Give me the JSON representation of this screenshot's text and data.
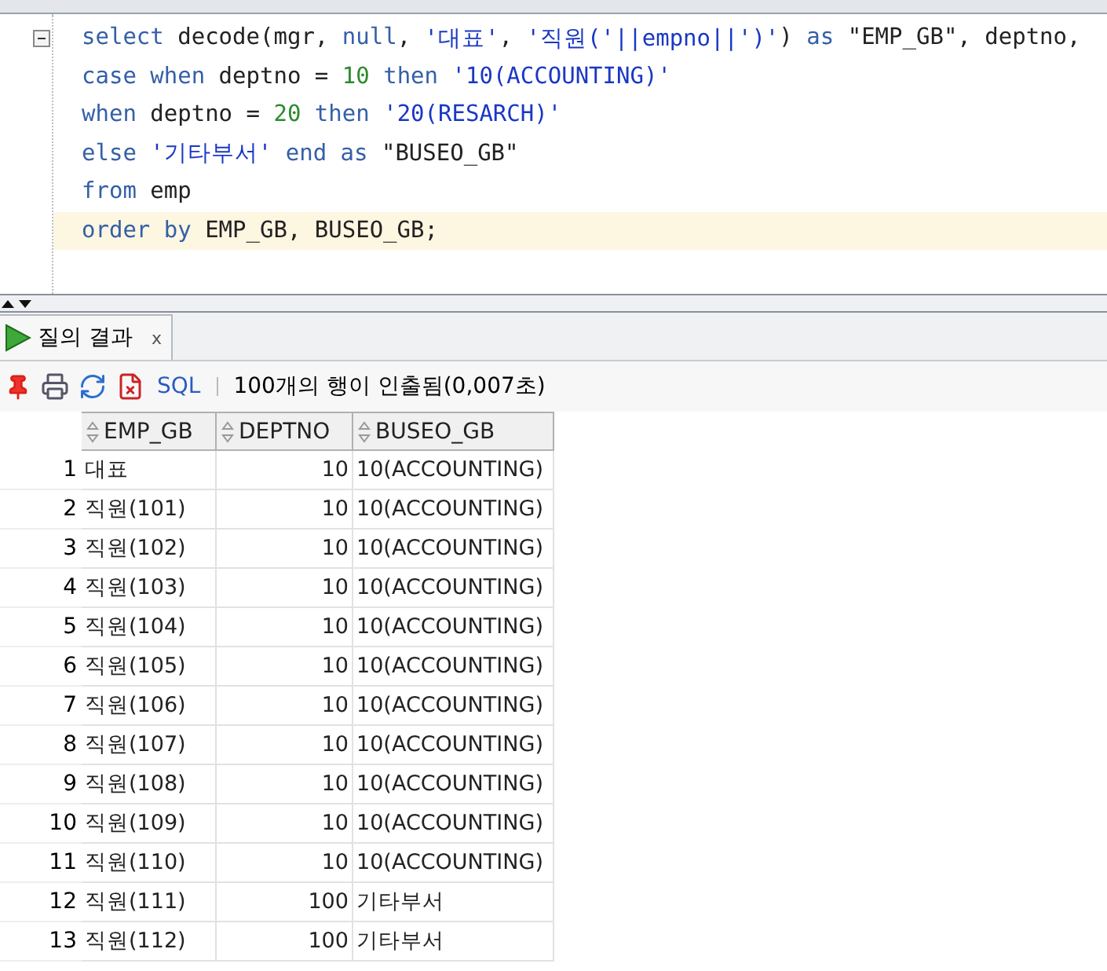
{
  "editor": {
    "lines": [
      {
        "folded_marker": true,
        "current": false,
        "tokens": [
          {
            "kind": "keyword",
            "text": "select"
          },
          {
            "kind": "plain",
            "text": " decode(mgr, "
          },
          {
            "kind": "keyword",
            "text": "null"
          },
          {
            "kind": "plain",
            "text": ", "
          },
          {
            "kind": "string",
            "text": "'대표'"
          },
          {
            "kind": "plain",
            "text": ", "
          },
          {
            "kind": "string",
            "text": "'직원('||empno||')'"
          },
          {
            "kind": "plain",
            "text": ") "
          },
          {
            "kind": "keyword",
            "text": "as"
          },
          {
            "kind": "plain",
            "text": " \"EMP_GB\", deptno,"
          }
        ]
      },
      {
        "folded_marker": false,
        "current": false,
        "tokens": [
          {
            "kind": "keyword",
            "text": "case when"
          },
          {
            "kind": "plain",
            "text": " deptno = "
          },
          {
            "kind": "number",
            "text": "10"
          },
          {
            "kind": "keyword",
            "text": " then "
          },
          {
            "kind": "string",
            "text": "'10(ACCOUNTING)'"
          }
        ]
      },
      {
        "folded_marker": false,
        "current": false,
        "tokens": [
          {
            "kind": "keyword",
            "text": "when"
          },
          {
            "kind": "plain",
            "text": " deptno = "
          },
          {
            "kind": "number",
            "text": "20"
          },
          {
            "kind": "keyword",
            "text": " then "
          },
          {
            "kind": "string",
            "text": "'20(RESARCH)'"
          }
        ]
      },
      {
        "folded_marker": false,
        "current": false,
        "tokens": [
          {
            "kind": "keyword",
            "text": "else "
          },
          {
            "kind": "string",
            "text": "'기타부서'"
          },
          {
            "kind": "keyword",
            "text": " end as "
          },
          {
            "kind": "plain",
            "text": "\"BUSEO_GB\""
          }
        ]
      },
      {
        "folded_marker": false,
        "current": false,
        "tokens": [
          {
            "kind": "keyword",
            "text": "from"
          },
          {
            "kind": "plain",
            "text": " emp"
          }
        ]
      },
      {
        "folded_marker": false,
        "current": true,
        "tokens": [
          {
            "kind": "keyword",
            "text": "order by"
          },
          {
            "kind": "plain",
            "text": " EMP_GB, BUSEO_GB;"
          }
        ]
      }
    ]
  },
  "results_tab": {
    "label": "질의 결과",
    "close": "x",
    "selected": true
  },
  "toolbar": {
    "sql_label": "SQL",
    "status": "100개의 행이 인출됨(0,007초)"
  },
  "table": {
    "columns": [
      "EMP_GB",
      "DEPTNO",
      "BUSEO_GB"
    ],
    "rows": [
      {
        "num": "1",
        "cells": [
          "대표",
          "10",
          "10(ACCOUNTING)"
        ]
      },
      {
        "num": "2",
        "cells": [
          "직원(101)",
          "10",
          "10(ACCOUNTING)"
        ]
      },
      {
        "num": "3",
        "cells": [
          "직원(102)",
          "10",
          "10(ACCOUNTING)"
        ]
      },
      {
        "num": "4",
        "cells": [
          "직원(103)",
          "10",
          "10(ACCOUNTING)"
        ]
      },
      {
        "num": "5",
        "cells": [
          "직원(104)",
          "10",
          "10(ACCOUNTING)"
        ]
      },
      {
        "num": "6",
        "cells": [
          "직원(105)",
          "10",
          "10(ACCOUNTING)"
        ]
      },
      {
        "num": "7",
        "cells": [
          "직원(106)",
          "10",
          "10(ACCOUNTING)"
        ]
      },
      {
        "num": "8",
        "cells": [
          "직원(107)",
          "10",
          "10(ACCOUNTING)"
        ]
      },
      {
        "num": "9",
        "cells": [
          "직원(108)",
          "10",
          "10(ACCOUNTING)"
        ]
      },
      {
        "num": "10",
        "cells": [
          "직원(109)",
          "10",
          "10(ACCOUNTING)"
        ]
      },
      {
        "num": "11",
        "cells": [
          "직원(110)",
          "10",
          "10(ACCOUNTING)"
        ]
      },
      {
        "num": "12",
        "cells": [
          "직원(111)",
          "100",
          "기타부서"
        ]
      },
      {
        "num": "13",
        "cells": [
          "직원(112)",
          "100",
          "기타부서"
        ]
      }
    ]
  }
}
